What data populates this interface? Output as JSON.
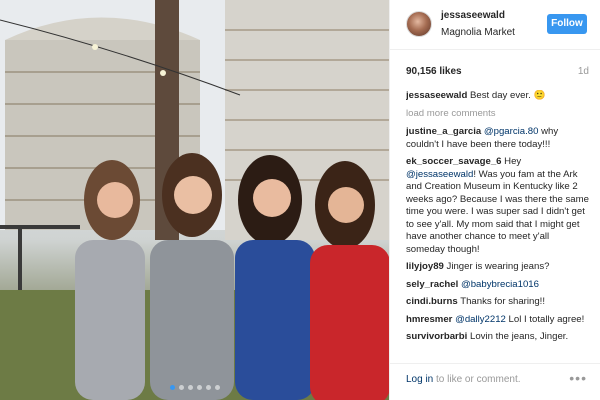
{
  "post": {
    "username": "jessaseewald",
    "location": "Magnolia Market",
    "follow_label": "Follow",
    "likes": "90,156 likes",
    "time": "1d",
    "caption_user": "jessaseewald",
    "caption_text": " Best day ever. 🙂",
    "load_more": "load more comments",
    "photo_dots": 6,
    "active_dot": 0
  },
  "comments": [
    {
      "user": "justine_a_garcia",
      "mention": "@pgarcia.80",
      "text": " why couldn't I have been there today!!!"
    },
    {
      "user": "ek_soccer_savage_6",
      "pre": " Hey ",
      "mention": "@jessaseewald",
      "text": "! Was you fam at the Ark and Creation Museum in Kentucky like 2 weeks ago? Because I was there the same time you were. I was super sad I didn't get to see y'all. My mom said that I might get have another chance to meet y'all someday though!"
    },
    {
      "user": "lilyjoy89",
      "text": " Jinger is wearing jeans?"
    },
    {
      "user": "sely_rachel",
      "mention": "@babybrecia1016",
      "text": ""
    },
    {
      "user": "cindi.burns",
      "text": " Thanks for sharing!!"
    },
    {
      "user": "hmresmer",
      "mention": "@dally2212",
      "text": " Lol I totally agree!"
    },
    {
      "user": "survivorbarbi",
      "text": " Lovin the jeans, Jinger."
    }
  ],
  "footer": {
    "login_link": "Log in",
    "login_text": " to like or comment.",
    "more_icon": "•••"
  },
  "colors": {
    "accent": "#3897f0",
    "mention": "#003569",
    "muted": "#999999"
  }
}
